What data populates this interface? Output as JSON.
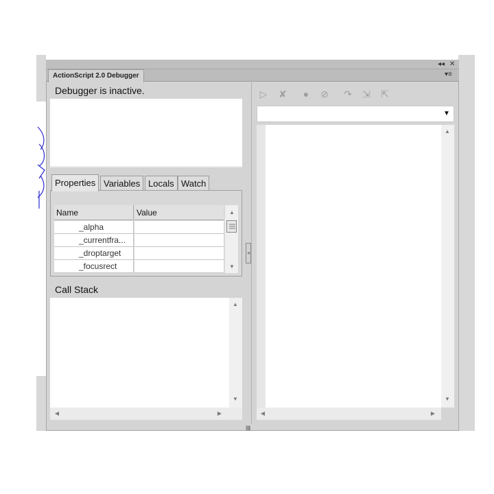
{
  "window": {
    "tab_title": "ActionScript 2.0 Debugger",
    "collapse_glyph": "◂◂",
    "close_glyph": "✕",
    "menu_glyph": "▾≡"
  },
  "debugger": {
    "status": "Debugger is inactive."
  },
  "inspector": {
    "tabs": [
      {
        "label": "Properties",
        "active": true
      },
      {
        "label": "Variables",
        "active": false
      },
      {
        "label": "Locals",
        "active": false
      },
      {
        "label": "Watch",
        "active": false
      }
    ],
    "columns": [
      "Name",
      "Value"
    ],
    "rows": [
      {
        "name": "_alpha",
        "value": ""
      },
      {
        "name": "_currentfra...",
        "value": ""
      },
      {
        "name": "_droptarget",
        "value": ""
      },
      {
        "name": "_focusrect",
        "value": ""
      }
    ]
  },
  "callstack": {
    "title": "Call Stack"
  },
  "toolbar": {
    "icons": [
      {
        "name": "continue-icon",
        "glyph": "▷"
      },
      {
        "name": "stop-debugging-icon",
        "glyph": "✘"
      },
      {
        "name": "toggle-breakpoint-icon",
        "glyph": "●"
      },
      {
        "name": "remove-all-breakpoints-icon",
        "glyph": "⊘"
      },
      {
        "name": "step-over-icon",
        "glyph": "↷"
      },
      {
        "name": "step-in-icon",
        "glyph": "⇲"
      },
      {
        "name": "step-out-icon",
        "glyph": "⇱"
      }
    ]
  },
  "script_selector": {
    "value": ""
  },
  "glyphs": {
    "up": "▲",
    "down": "▼",
    "left": "◀",
    "right": "▶",
    "dropdown": "▼",
    "grip": "||||||||",
    "splitter": "◂"
  },
  "colors": {
    "panel_bg": "#d4d4d4",
    "title_strip": "#bfbfbf",
    "doodle_ink": "#2a2ad0"
  }
}
